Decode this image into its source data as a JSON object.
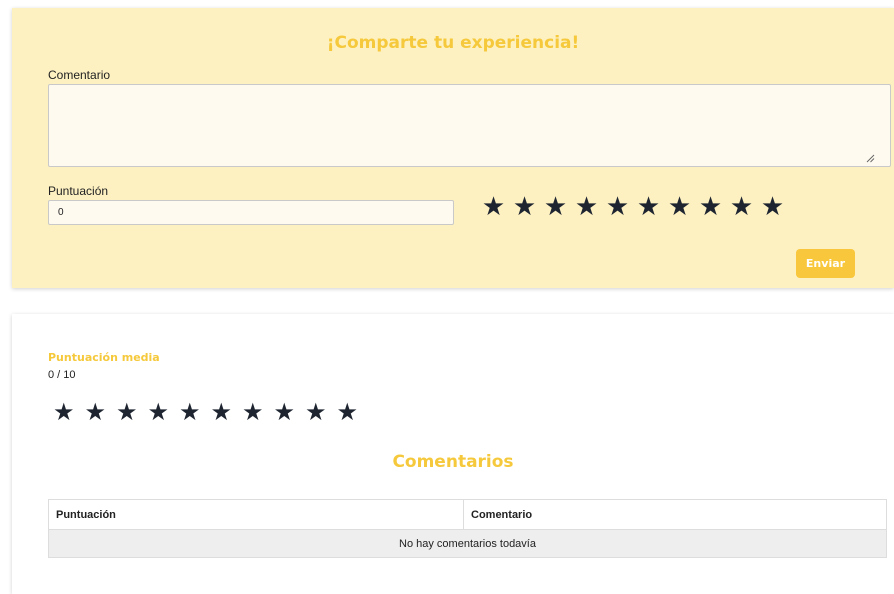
{
  "form": {
    "title": "¡Comparte tu experiencia!",
    "comment_label": "Comentario",
    "comment_value": "",
    "score_label": "Puntuación",
    "score_value": "0",
    "stars": 10,
    "rating_filled": 0,
    "submit_label": "Enviar"
  },
  "summary": {
    "avg_label": "Puntuación media",
    "avg_value": "0 / 10",
    "stars": 10,
    "rating_filled": 0
  },
  "comments": {
    "heading": "Comentarios",
    "columns": [
      "Puntuación",
      "Comentario"
    ],
    "empty_text": "No hay comentarios todavía",
    "rows": []
  },
  "colors": {
    "accent": "#f5c93b",
    "form_background": "#fdf1c2",
    "star": "#1e2530"
  },
  "icons": {
    "star": "star-icon",
    "resize": "resize-grip-icon"
  }
}
